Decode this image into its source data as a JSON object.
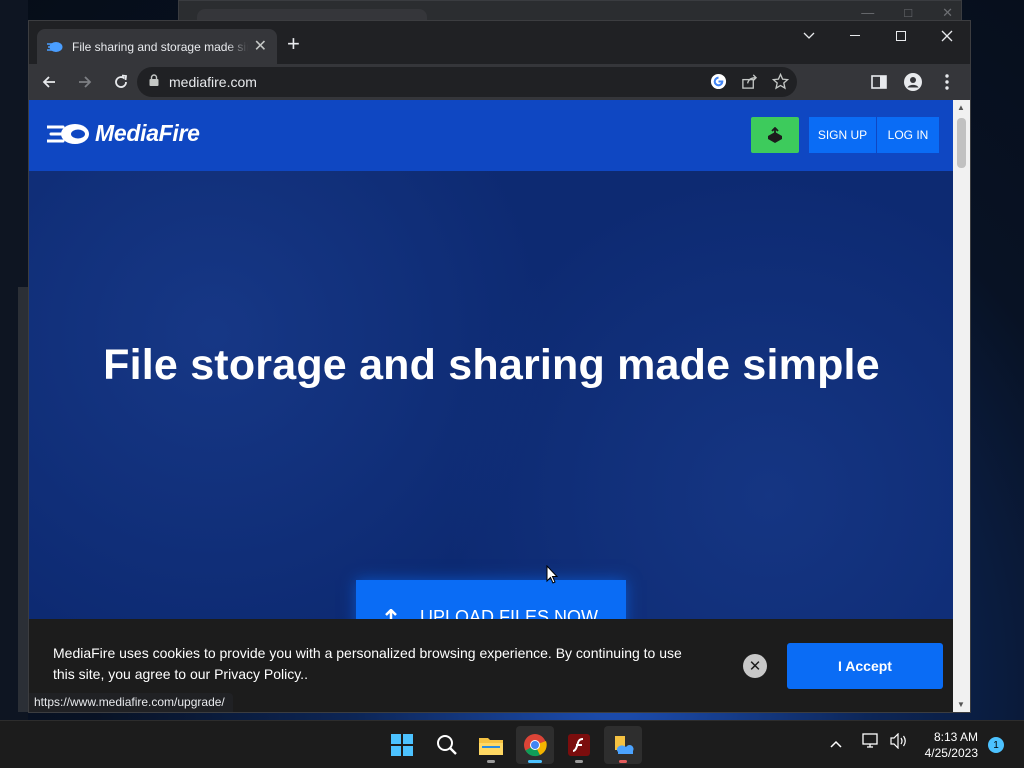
{
  "browser": {
    "tab_title": "File sharing and storage made simple",
    "url": "mediafire.com",
    "status_url": "https://www.mediafire.com/upgrade/"
  },
  "site": {
    "logo_text": "MediaFire",
    "signup_label": "SIGN UP",
    "login_label": "LOG IN",
    "hero_title": "File storage and sharing made simple",
    "upload_button_label": "UPLOAD FILES NOW"
  },
  "cookie_banner": {
    "text": "MediaFire uses cookies to provide you with a personalized browsing experience. By continuing to use this site, you agree to our Privacy Policy..",
    "accept_label": "I Accept"
  },
  "taskbar": {
    "apps": [
      "start-icon",
      "search-icon",
      "file-explorer-icon",
      "chrome-icon",
      "flash-icon",
      "folder-app-icon"
    ],
    "time": "8:13 AM",
    "date": "4/25/2023",
    "notification_count": "1"
  },
  "colors": {
    "brand_blue": "#0f47c2",
    "button_blue": "#0a6cf5",
    "upload_green": "#3dcb5c"
  }
}
